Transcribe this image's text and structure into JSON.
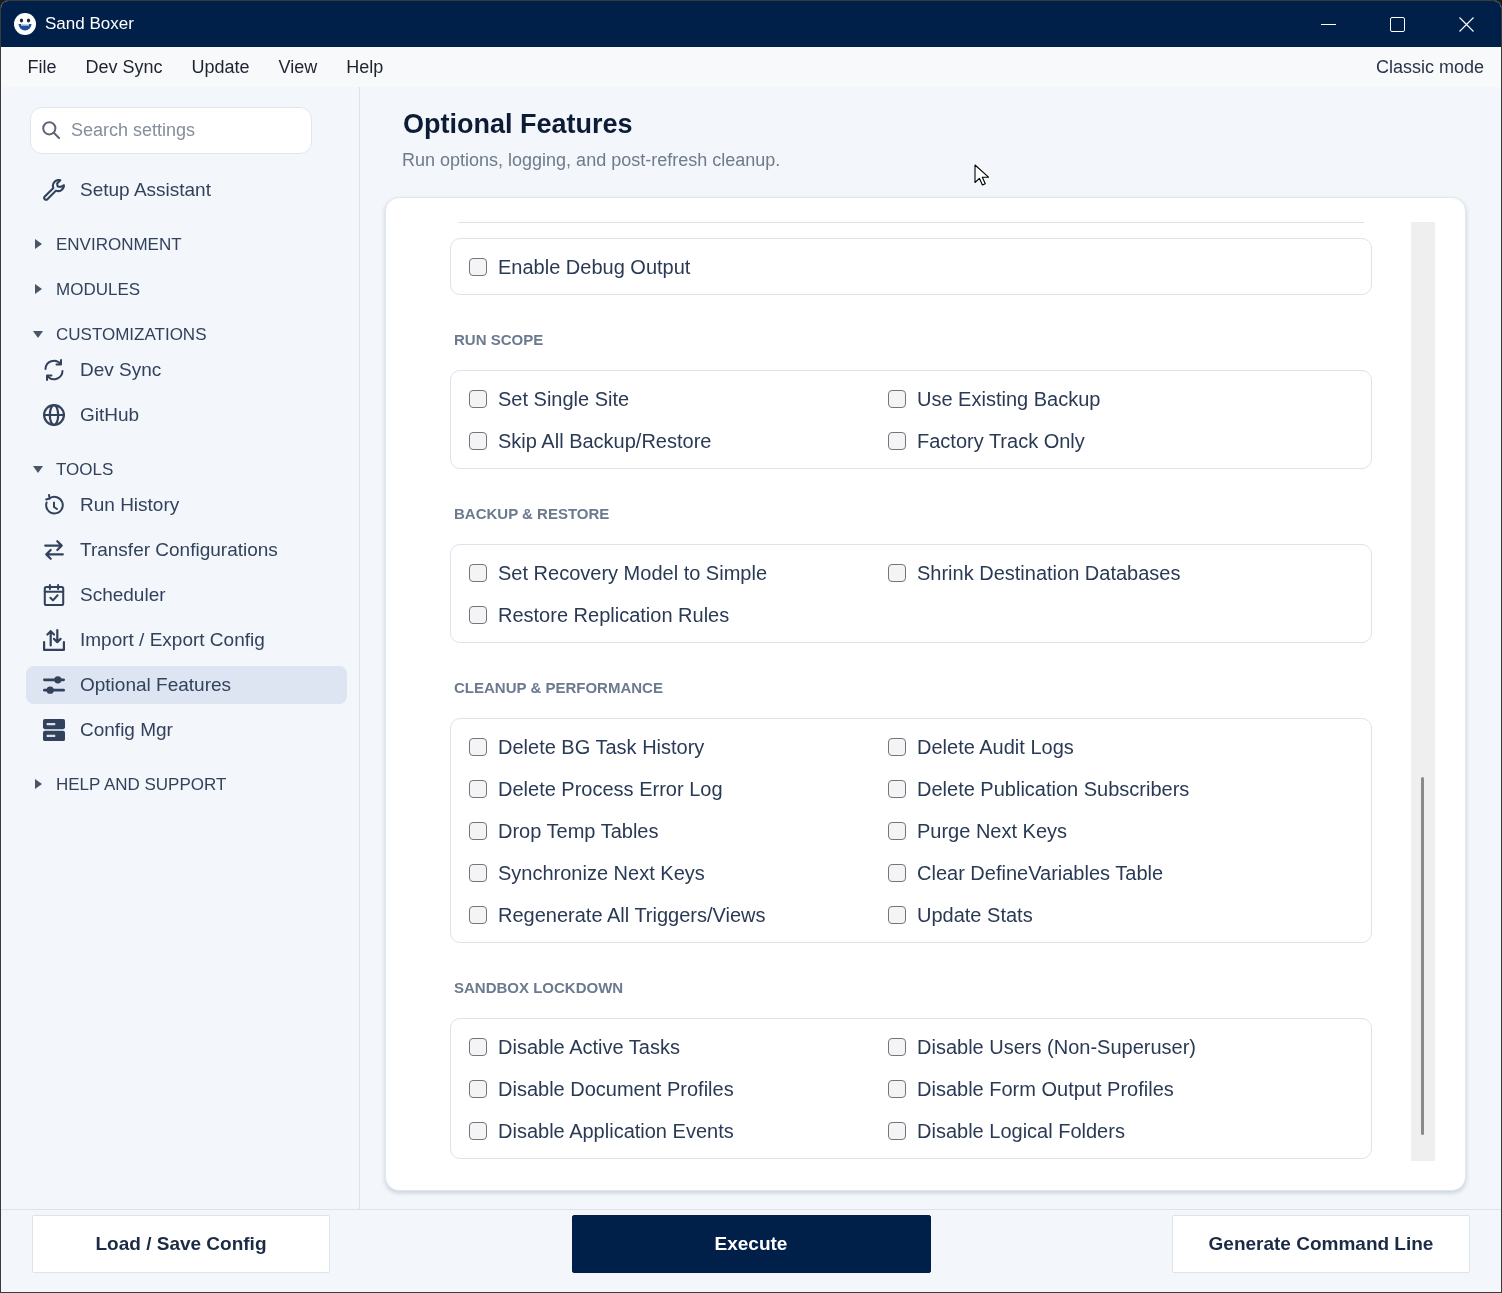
{
  "window": {
    "title": "Sand Boxer"
  },
  "menu": {
    "items": [
      "File",
      "Dev Sync",
      "Update",
      "View",
      "Help"
    ],
    "mode_link": "Classic mode"
  },
  "sidebar": {
    "search": {
      "placeholder": "Search settings"
    },
    "items": [
      {
        "kind": "link",
        "label": "Setup Assistant",
        "selected": false
      },
      {
        "kind": "section",
        "label": "ENVIRONMENT",
        "expanded": false
      },
      {
        "kind": "section",
        "label": "MODULES",
        "expanded": false
      },
      {
        "kind": "section",
        "label": "CUSTOMIZATIONS",
        "expanded": true,
        "children": [
          {
            "label": "Dev Sync",
            "selected": false
          },
          {
            "label": "GitHub",
            "selected": false
          }
        ]
      },
      {
        "kind": "section",
        "label": "TOOLS",
        "expanded": true,
        "children": [
          {
            "label": "Run History",
            "selected": false
          },
          {
            "label": "Transfer Configurations",
            "selected": false
          },
          {
            "label": "Scheduler",
            "selected": false
          },
          {
            "label": "Import / Export Config",
            "selected": false
          },
          {
            "label": "Optional Features",
            "selected": true
          },
          {
            "label": "Config Mgr",
            "selected": false
          }
        ]
      },
      {
        "kind": "section",
        "label": "HELP AND SUPPORT",
        "expanded": false
      }
    ]
  },
  "page": {
    "title": "Optional Features",
    "subtitle": "Run options, logging, and post-refresh cleanup."
  },
  "groups": [
    {
      "options": [
        {
          "label": "Enable Debug Output",
          "checked": false
        }
      ]
    },
    {
      "heading": "RUN SCOPE",
      "options": [
        {
          "label": "Set Single Site",
          "checked": false
        },
        {
          "label": "Use Existing Backup",
          "checked": false
        },
        {
          "label": "Skip All Backup/Restore",
          "checked": false
        },
        {
          "label": "Factory Track Only",
          "checked": false
        }
      ]
    },
    {
      "heading": "BACKUP & RESTORE",
      "options": [
        {
          "label": "Set Recovery Model to Simple",
          "checked": false
        },
        {
          "label": "Shrink Destination Databases",
          "checked": false
        },
        {
          "label": "Restore Replication Rules",
          "checked": false
        }
      ]
    },
    {
      "heading": "CLEANUP & PERFORMANCE",
      "options": [
        {
          "label": "Delete BG Task History",
          "checked": false
        },
        {
          "label": "Delete Audit Logs",
          "checked": false
        },
        {
          "label": "Delete Process Error Log",
          "checked": false
        },
        {
          "label": "Delete Publication Subscribers",
          "checked": false
        },
        {
          "label": "Drop Temp Tables",
          "checked": false
        },
        {
          "label": "Purge Next Keys",
          "checked": false
        },
        {
          "label": "Synchronize Next Keys",
          "checked": false
        },
        {
          "label": "Clear DefineVariables Table",
          "checked": false
        },
        {
          "label": "Regenerate All Triggers/Views",
          "checked": false
        },
        {
          "label": "Update Stats",
          "checked": false
        }
      ]
    },
    {
      "heading": "SANDBOX LOCKDOWN",
      "options": [
        {
          "label": "Disable Active Tasks",
          "checked": false
        },
        {
          "label": "Disable Users (Non-Superuser)",
          "checked": false
        },
        {
          "label": "Disable Document Profiles",
          "checked": false
        },
        {
          "label": "Disable Form Output Profiles",
          "checked": false
        },
        {
          "label": "Disable Application Events",
          "checked": false
        },
        {
          "label": "Disable Logical Folders",
          "checked": false
        }
      ]
    }
  ],
  "footer": {
    "buttons": [
      {
        "label": "Load / Save Config",
        "kind": "secondary"
      },
      {
        "label": "Execute",
        "kind": "primary"
      },
      {
        "label": "Generate Command Line",
        "kind": "secondary"
      }
    ]
  }
}
